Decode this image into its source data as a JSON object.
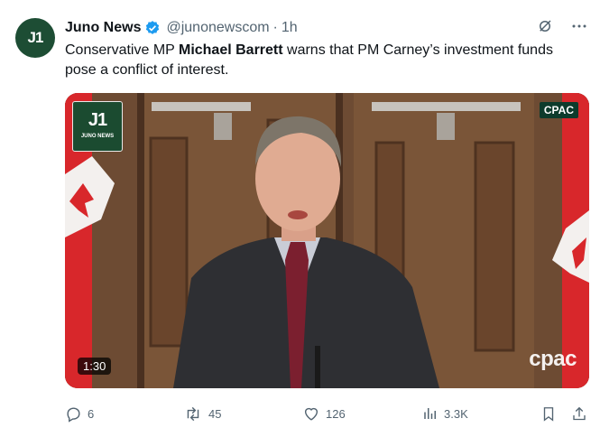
{
  "tweet": {
    "author_name": "Juno News",
    "author_handle": "@junonewscom",
    "time": "1h",
    "avatar_text": "J1",
    "text_parts": [
      "Conservative MP ",
      "Michael Barrett",
      " warns that PM Carney’s investment funds pose a conflict of interest."
    ]
  },
  "video": {
    "logo_text": "J1",
    "logo_subtext": "JUNO NEWS",
    "network_badge": "CPAC",
    "watermark": "cpac",
    "duration": "1:30"
  },
  "actions": {
    "replies": "6",
    "reposts": "45",
    "likes": "126",
    "views": "3.3K"
  },
  "colors": {
    "avatar_bg": "#1d4d34",
    "verified": "#1d9bf0",
    "secondary_text": "#536471"
  }
}
